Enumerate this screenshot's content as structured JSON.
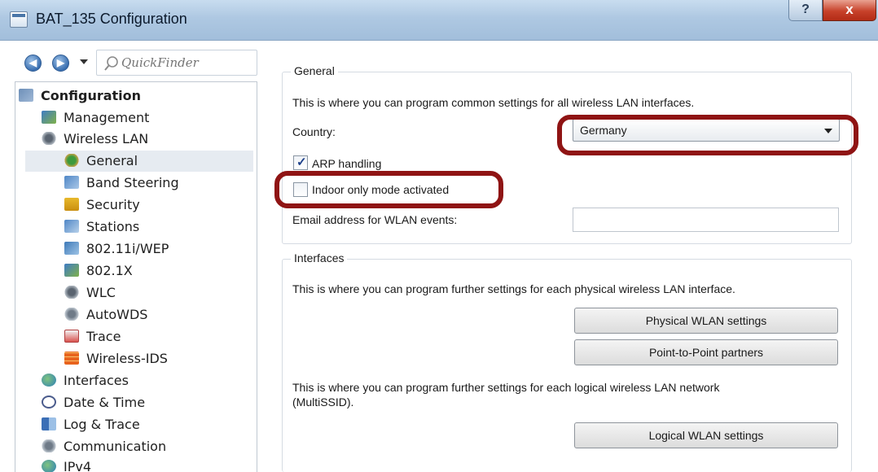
{
  "window": {
    "title": "BAT_135 Configuration",
    "help_label": "?",
    "close_label": "x"
  },
  "nav": {
    "back_label": "◀",
    "forward_label": "▶",
    "search_placeholder": "QuickFinder"
  },
  "tree": {
    "root": "Configuration",
    "management": "Management",
    "wireless_lan": "Wireless LAN",
    "general": "General",
    "band_steering": "Band Steering",
    "security": "Security",
    "stations": "Stations",
    "wep": "802.11i/WEP",
    "dot1x": "802.1X",
    "wlc": "WLC",
    "autowds": "AutoWDS",
    "trace": "Trace",
    "wireless_ids": "Wireless-IDS",
    "interfaces": "Interfaces",
    "date_time": "Date & Time",
    "log_trace": "Log & Trace",
    "communication": "Communication",
    "ipv4": "IPv4"
  },
  "general": {
    "title": "General",
    "description": "This is where you can program common settings for all wireless LAN interfaces.",
    "country_label": "Country:",
    "country_value": "Germany",
    "arp_label": "ARP handling",
    "arp_checked": true,
    "indoor_label": "Indoor only mode activated",
    "indoor_checked": false,
    "email_label": "Email address for WLAN events:",
    "email_value": ""
  },
  "interfaces": {
    "title": "Interfaces",
    "physical_description": "This is where you can program further settings for each physical wireless LAN interface.",
    "physical_button": "Physical WLAN settings",
    "p2p_button": "Point-to-Point partners",
    "logical_description_line1": "This is where you can program further settings for each logical wireless LAN network",
    "logical_description_line2": "(MultiSSID).",
    "logical_button": "Logical WLAN settings"
  },
  "colors": {
    "highlight": "#8f1414",
    "titlebar": "#aec8e2",
    "close_button": "#c7412a"
  }
}
